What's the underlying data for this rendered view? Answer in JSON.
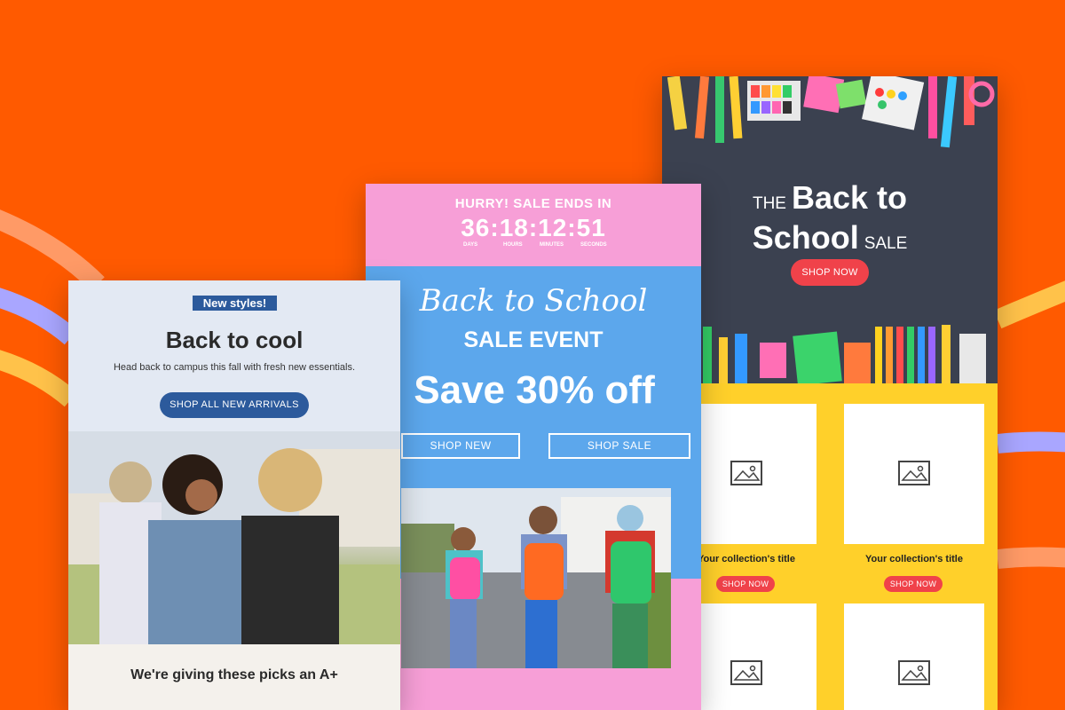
{
  "colors": {
    "background": "#ff5a00",
    "right_accent": "#ffd02a",
    "red_button": "#f0424a",
    "pink": "#f79fd7",
    "blue": "#5ca7ec",
    "navy": "#2c5a9c"
  },
  "right_card": {
    "title_the": "THE",
    "title_big_1": "Back to",
    "title_big_2": "School",
    "title_sale": "SALE",
    "shop_now": "SHOP NOW",
    "products": [
      {
        "title": "Your collection's title",
        "button": "SHOP NOW"
      },
      {
        "title": "Your collection's title",
        "button": "SHOP NOW"
      }
    ],
    "product_icon": "image-placeholder-icon"
  },
  "middle_card": {
    "hurry": "HURRY! SALE ENDS IN",
    "timer": "36:18:12:51",
    "timer_labels": [
      "DAYS",
      "HOURS",
      "MINUTES",
      "SECONDS"
    ],
    "script_title": "Back to School",
    "event": "SALE EVENT",
    "save": "Save 30% off",
    "shop_new": "SHOP NEW",
    "shop_sale": "SHOP SALE"
  },
  "left_card": {
    "badge": "New styles!",
    "title": "Back to cool",
    "subtitle": "Head back to campus this fall with fresh new essentials.",
    "button": "SHOP ALL NEW ARRIVALS",
    "footer": "We're giving these picks an A+"
  }
}
